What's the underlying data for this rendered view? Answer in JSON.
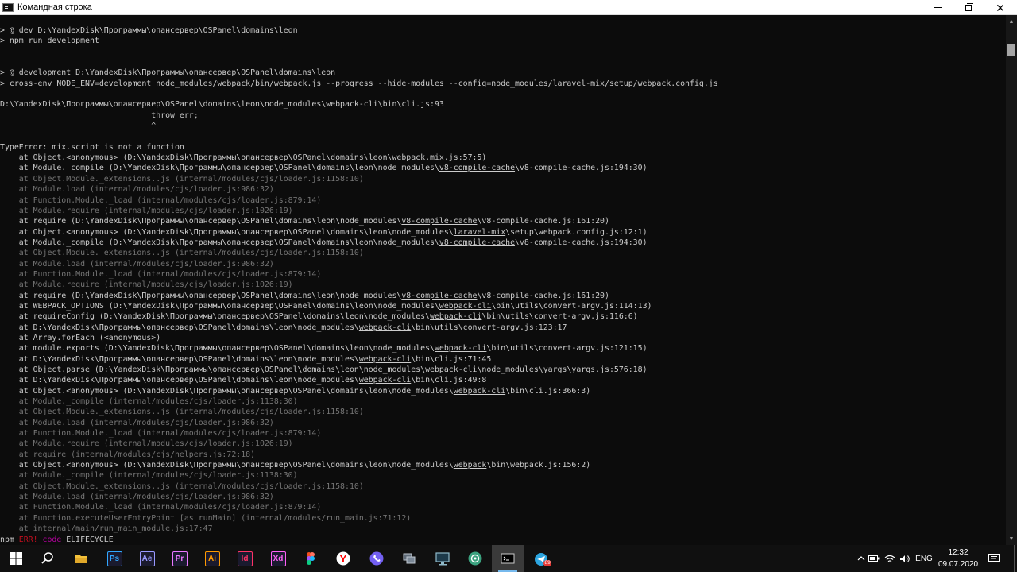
{
  "window": {
    "title": "Командная строка"
  },
  "console_lines": [
    {
      "t": "> @ dev D:\\YandexDisk\\Программы\\опансервер\\OSPanel\\domains\\leon"
    },
    {
      "t": "> npm run development"
    },
    {
      "t": ""
    },
    {
      "t": ""
    },
    {
      "t": "> @ development D:\\YandexDisk\\Программы\\опансервер\\OSPanel\\domains\\leon"
    },
    {
      "t": "> cross-env NODE_ENV=development node_modules/webpack/bin/webpack.js --progress --hide-modules --config=node_modules/laravel-mix/setup/webpack.config.js"
    },
    {
      "t": ""
    },
    {
      "t": "D:\\YandexDisk\\Программы\\опансервер\\OSPanel\\domains\\leon\\node_modules\\webpack-cli\\bin\\cli.js:93"
    },
    {
      "t": "                                throw err;"
    },
    {
      "t": "                                ^"
    },
    {
      "t": ""
    },
    {
      "t": "TypeError: mix.script is not a function"
    },
    {
      "t": "    at Object.<anonymous> (D:\\YandexDisk\\Программы\\опансервер\\OSPanel\\domains\\leon\\webpack.mix.js:57:5)"
    },
    {
      "t": "    at Module._compile (D:\\YandexDisk\\Программы\\опансервер\\OSPanel\\domains\\leon\\node_modules\\v8-compile-cache\\v8-compile-cache.js:194:30)",
      "u": "v8-compile-cache"
    },
    {
      "t": "    at Object.Module._extensions..js (internal/modules/cjs/loader.js:1158:10)",
      "dim": true
    },
    {
      "t": "    at Module.load (internal/modules/cjs/loader.js:986:32)",
      "dim": true
    },
    {
      "t": "    at Function.Module._load (internal/modules/cjs/loader.js:879:14)",
      "dim": true
    },
    {
      "t": "    at Module.require (internal/modules/cjs/loader.js:1026:19)",
      "dim": true
    },
    {
      "t": "    at require (D:\\YandexDisk\\Программы\\опансервер\\OSPanel\\domains\\leon\\node_modules\\v8-compile-cache\\v8-compile-cache.js:161:20)",
      "u": "v8-compile-cache"
    },
    {
      "t": "    at Object.<anonymous> (D:\\YandexDisk\\Программы\\опансервер\\OSPanel\\domains\\leon\\node_modules\\laravel-mix\\setup\\webpack.config.js:12:1)",
      "u": "laravel-mix"
    },
    {
      "t": "    at Module._compile (D:\\YandexDisk\\Программы\\опансервер\\OSPanel\\domains\\leon\\node_modules\\v8-compile-cache\\v8-compile-cache.js:194:30)",
      "u": "v8-compile-cache"
    },
    {
      "t": "    at Object.Module._extensions..js (internal/modules/cjs/loader.js:1158:10)",
      "dim": true
    },
    {
      "t": "    at Module.load (internal/modules/cjs/loader.js:986:32)",
      "dim": true
    },
    {
      "t": "    at Function.Module._load (internal/modules/cjs/loader.js:879:14)",
      "dim": true
    },
    {
      "t": "    at Module.require (internal/modules/cjs/loader.js:1026:19)",
      "dim": true
    },
    {
      "t": "    at require (D:\\YandexDisk\\Программы\\опансервер\\OSPanel\\domains\\leon\\node_modules\\v8-compile-cache\\v8-compile-cache.js:161:20)",
      "u": "v8-compile-cache"
    },
    {
      "t": "    at WEBPACK_OPTIONS (D:\\YandexDisk\\Программы\\опансервер\\OSPanel\\domains\\leon\\node_modules\\webpack-cli\\bin\\utils\\convert-argv.js:114:13)",
      "u": "webpack-cli"
    },
    {
      "t": "    at requireConfig (D:\\YandexDisk\\Программы\\опансервер\\OSPanel\\domains\\leon\\node_modules\\webpack-cli\\bin\\utils\\convert-argv.js:116:6)",
      "u": "webpack-cli"
    },
    {
      "t": "    at D:\\YandexDisk\\Программы\\опансервер\\OSPanel\\domains\\leon\\node_modules\\webpack-cli\\bin\\utils\\convert-argv.js:123:17",
      "u": "webpack-cli"
    },
    {
      "t": "    at Array.forEach (<anonymous>)"
    },
    {
      "t": "    at module.exports (D:\\YandexDisk\\Программы\\опансервер\\OSPanel\\domains\\leon\\node_modules\\webpack-cli\\bin\\utils\\convert-argv.js:121:15)",
      "u": "webpack-cli"
    },
    {
      "t": "    at D:\\YandexDisk\\Программы\\опансервер\\OSPanel\\domains\\leon\\node_modules\\webpack-cli\\bin\\cli.js:71:45",
      "u": "webpack-cli"
    },
    {
      "t": "    at Object.parse (D:\\YandexDisk\\Программы\\опансервер\\OSPanel\\domains\\leon\\node_modules\\webpack-cli\\node_modules\\yargs\\yargs.js:576:18)",
      "u": "webpack-cli",
      "u2": "yargs"
    },
    {
      "t": "    at D:\\YandexDisk\\Программы\\опансервер\\OSPanel\\domains\\leon\\node_modules\\webpack-cli\\bin\\cli.js:49:8",
      "u": "webpack-cli"
    },
    {
      "t": "    at Object.<anonymous> (D:\\YandexDisk\\Программы\\опансервер\\OSPanel\\domains\\leon\\node_modules\\webpack-cli\\bin\\cli.js:366:3)",
      "u": "webpack-cli"
    },
    {
      "t": "    at Module._compile (internal/modules/cjs/loader.js:1138:30)",
      "dim": true
    },
    {
      "t": "    at Object.Module._extensions..js (internal/modules/cjs/loader.js:1158:10)",
      "dim": true
    },
    {
      "t": "    at Module.load (internal/modules/cjs/loader.js:986:32)",
      "dim": true
    },
    {
      "t": "    at Function.Module._load (internal/modules/cjs/loader.js:879:14)",
      "dim": true
    },
    {
      "t": "    at Module.require (internal/modules/cjs/loader.js:1026:19)",
      "dim": true
    },
    {
      "t": "    at require (internal/modules/cjs/helpers.js:72:18)",
      "dim": true
    },
    {
      "t": "    at Object.<anonymous> (D:\\YandexDisk\\Программы\\опансервер\\OSPanel\\domains\\leon\\node_modules\\webpack\\bin\\webpack.js:156:2)",
      "u": "\\webpack\\"
    },
    {
      "t": "    at Module._compile (internal/modules/cjs/loader.js:1138:30)",
      "dim": true
    },
    {
      "t": "    at Object.Module._extensions..js (internal/modules/cjs/loader.js:1158:10)",
      "dim": true
    },
    {
      "t": "    at Module.load (internal/modules/cjs/loader.js:986:32)",
      "dim": true
    },
    {
      "t": "    at Function.Module._load (internal/modules/cjs/loader.js:879:14)",
      "dim": true
    },
    {
      "t": "    at Function.executeUserEntryPoint [as runMain] (internal/modules/run_main.js:71:12)",
      "dim": true
    },
    {
      "t": "    at internal/main/run_main_module.js:17:47",
      "dim": true
    },
    {
      "t": "npm ERR! code ELIFECYCLE",
      "npm": true
    }
  ],
  "npm_err": {
    "prefix": "npm ",
    "err": "ERR!",
    "code_word": "code",
    "code_value": "ELIFECYCLE"
  },
  "taskbar": {
    "apps": [
      {
        "name": "start-button",
        "label": "",
        "icon": "windows-logo",
        "color": "#ffffff"
      },
      {
        "name": "search-button",
        "label": "",
        "icon": "search",
        "color": "#ffffff"
      },
      {
        "name": "file-explorer",
        "label": "",
        "icon": "folder",
        "color": "#f3c13a"
      },
      {
        "name": "photoshop",
        "label": "Ps",
        "icon": "photoshop",
        "color": "#31a8ff"
      },
      {
        "name": "after-effects",
        "label": "Ae",
        "icon": "after-effects",
        "color": "#9999ff"
      },
      {
        "name": "premiere",
        "label": "Pr",
        "icon": "premiere",
        "color": "#ea77ff"
      },
      {
        "name": "illustrator",
        "label": "Ai",
        "icon": "illustrator",
        "color": "#ff9a00"
      },
      {
        "name": "indesign",
        "label": "Id",
        "icon": "indesign",
        "color": "#ff3366"
      },
      {
        "name": "adobe-xd",
        "label": "Xd",
        "icon": "adobe-xd",
        "color": "#ff61f6"
      },
      {
        "name": "figma",
        "label": "",
        "icon": "figma",
        "color": "#a259ff"
      },
      {
        "name": "yandex-browser",
        "label": "",
        "icon": "yandex",
        "color": "#ff0000"
      },
      {
        "name": "viber",
        "label": "",
        "icon": "viber",
        "color": "#7360f2"
      },
      {
        "name": "network-app",
        "label": "",
        "icon": "network",
        "color": "#bfc7d1"
      },
      {
        "name": "remote-desktop",
        "label": "",
        "icon": "monitor",
        "color": "#8fb9c9"
      },
      {
        "name": "chatgpt",
        "label": "",
        "icon": "spiral",
        "color": "#3aa17e"
      },
      {
        "name": "command-prompt",
        "label": "",
        "icon": "terminal",
        "color": "#cccccc"
      },
      {
        "name": "telegram",
        "label": "",
        "icon": "telegram",
        "color": "#2ca5e0"
      }
    ],
    "telegram_badge": "89",
    "tray": {
      "language": "ENG",
      "time": "12:32",
      "date": "09.07.2020"
    }
  },
  "colors": {
    "console_bg": "#0c0c0c",
    "console_text": "#cccccc",
    "console_dim": "#767676",
    "npm_err_red": "#c50f1f",
    "npm_code_magenta": "#b4009e",
    "taskbar_bg": "#101010"
  }
}
